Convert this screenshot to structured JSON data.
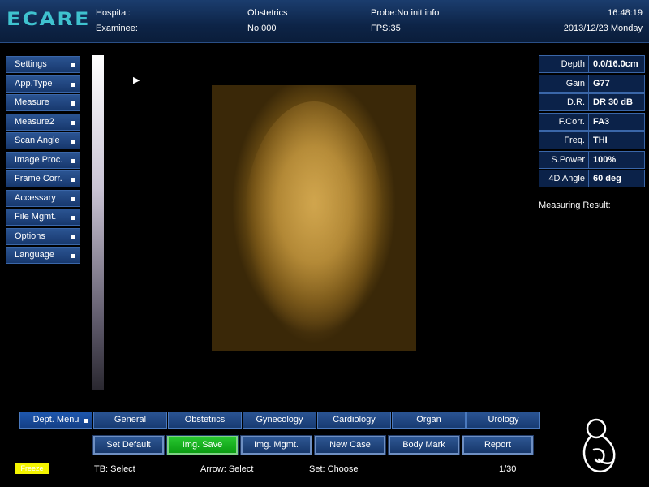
{
  "header": {
    "logo": "ECARE",
    "hospital_label": "Hospital:",
    "examinee_label": "Examinee:",
    "exam_type": "Obstetrics",
    "number": "No:000",
    "probe": "Probe:No init info",
    "fps": "FPS:35",
    "time": "16:48:19",
    "date": "2013/12/23 Monday"
  },
  "side_menu": {
    "items": [
      {
        "label": "Settings"
      },
      {
        "label": "App.Type"
      },
      {
        "label": "Measure"
      },
      {
        "label": "Measure2"
      },
      {
        "label": "Scan Angle"
      },
      {
        "label": "Image Proc."
      },
      {
        "label": "Frame Corr."
      },
      {
        "label": "Accessary"
      },
      {
        "label": "File Mgmt."
      },
      {
        "label": "Options"
      },
      {
        "label": "Language"
      }
    ]
  },
  "params": [
    {
      "label": "Depth",
      "value": "0.0/16.0cm"
    },
    {
      "label": "Gain",
      "value": "G77"
    },
    {
      "label": "D.R.",
      "value": "DR 30 dB"
    },
    {
      "label": "F.Corr.",
      "value": "FA3"
    },
    {
      "label": "Freq.",
      "value": "THI"
    },
    {
      "label": "S.Power",
      "value": "100%"
    },
    {
      "label": "4D Angle",
      "value": "60 deg"
    }
  ],
  "measuring_result": "Measuring Result:",
  "dept_menu": {
    "label": "Dept. Menu",
    "tabs": [
      "General",
      "Obstetrics",
      "Gynecology",
      "Cardiology",
      "Organ",
      "Urology"
    ]
  },
  "func_buttons": [
    "Set Default",
    "Img. Save",
    "Img. Mgmt.",
    "New Case",
    "Body Mark",
    "Report"
  ],
  "status": {
    "badge": "Freeze",
    "tb": "TB: Select",
    "arrow": "Arrow: Select",
    "set": "Set: Choose",
    "page": "1/30"
  },
  "colors": {
    "accent": "#3fc2cf",
    "panel": "#17386d",
    "active_button": "#27c52f",
    "status_badge": "#f5f500"
  },
  "icons": [
    "cursor-arrow-icon",
    "fetus-icon"
  ]
}
